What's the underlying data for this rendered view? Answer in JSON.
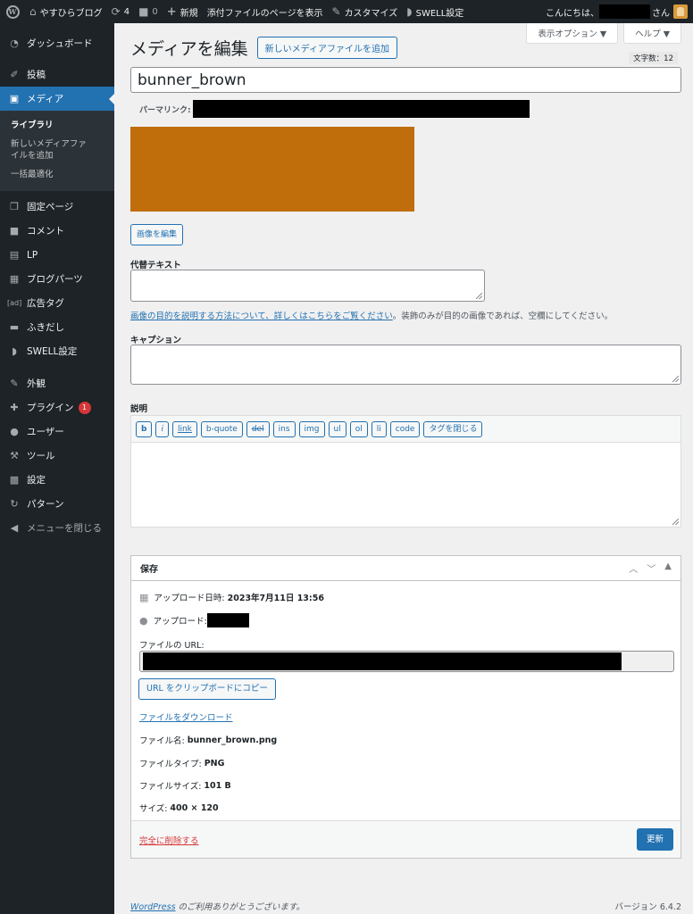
{
  "adminbar": {
    "site_name": "やすひらブログ",
    "updates_count": "4",
    "comments_count": "0",
    "new_label": "新規",
    "view_attachment": "添付ファイルのページを表示",
    "customize": "カスタマイズ",
    "swell_settings": "SWELL設定",
    "greeting": "こんにちは、",
    "greeting_suffix": "さん"
  },
  "sidebar": {
    "items": [
      {
        "label": "ダッシュボード",
        "icon": "dashboard-icon"
      },
      {
        "label": "投稿",
        "icon": "pin-icon"
      },
      {
        "label": "メディア",
        "icon": "media-icon"
      },
      {
        "label": "固定ページ",
        "icon": "page-icon"
      },
      {
        "label": "コメント",
        "icon": "comment-icon"
      },
      {
        "label": "LP",
        "icon": "document-icon"
      },
      {
        "label": "ブログパーツ",
        "icon": "layout-icon"
      },
      {
        "label": "広告タグ",
        "icon": "ad-icon"
      },
      {
        "label": "ふきだし",
        "icon": "bubble-icon"
      },
      {
        "label": "SWELL設定",
        "icon": "swell-icon"
      },
      {
        "label": "外観",
        "icon": "brush-icon"
      },
      {
        "label": "プラグイン",
        "icon": "plugin-icon",
        "badge": "1"
      },
      {
        "label": "ユーザー",
        "icon": "user-icon"
      },
      {
        "label": "ツール",
        "icon": "wrench-icon"
      },
      {
        "label": "設定",
        "icon": "settings-icon"
      },
      {
        "label": "パターン",
        "icon": "pattern-icon"
      },
      {
        "label": "メニューを閉じる",
        "icon": "collapse-icon"
      }
    ],
    "submenu": [
      {
        "label": "ライブラリ"
      },
      {
        "label": "新しいメディアファイルを追加"
      },
      {
        "label": "一括最適化"
      }
    ]
  },
  "screen_options": "表示オプション ▼",
  "help": "ヘルプ ▼",
  "page": {
    "title": "メディアを編集",
    "add_new": "新しいメディアファイルを追加",
    "char_count": "文字数：12",
    "title_value": "bunner_brown",
    "permalink_label": "パーマリンク:",
    "edit_image": "画像を編集",
    "alt_label": "代替テキスト",
    "alt_help_link": "画像の目的を説明する方法について、詳しくはこちらをご覧ください",
    "alt_help_rest": "。装飾のみが目的の画像であれば、空欄にしてください。",
    "caption_label": "キャプション",
    "description_label": "説明"
  },
  "quicktags": [
    "b",
    "i",
    "link",
    "b-quote",
    "del",
    "ins",
    "img",
    "ul",
    "ol",
    "li",
    "code",
    "タグを閉じる"
  ],
  "savebox": {
    "title": "保存",
    "uploaded_on_label": "アップロード日時:",
    "uploaded_on_value": "2023年7月11日 13:56",
    "uploaded_by_label": "アップロード:",
    "file_url_label": "ファイルの URL:",
    "copy_button": "URL をクリップボードにコピー",
    "download_link": "ファイルをダウンロード",
    "file_name_label": "ファイル名:",
    "file_name": "bunner_brown.png",
    "file_type_label": "ファイルタイプ:",
    "file_type": "PNG",
    "file_size_label": "ファイルサイズ:",
    "file_size": "101 B",
    "dimensions_label": "サイズ:",
    "dimensions": "400 × 120",
    "delete_link": "完全に削除する",
    "update_button": "更新"
  },
  "footer": {
    "wp_link": "WordPress",
    "thanks": " のご利用ありがとうございます。",
    "version": "バージョン 6.4.2"
  },
  "colors": {
    "preview_image": "#c06d0b",
    "accent": "#2271b1",
    "admin_dark": "#1d2327"
  }
}
